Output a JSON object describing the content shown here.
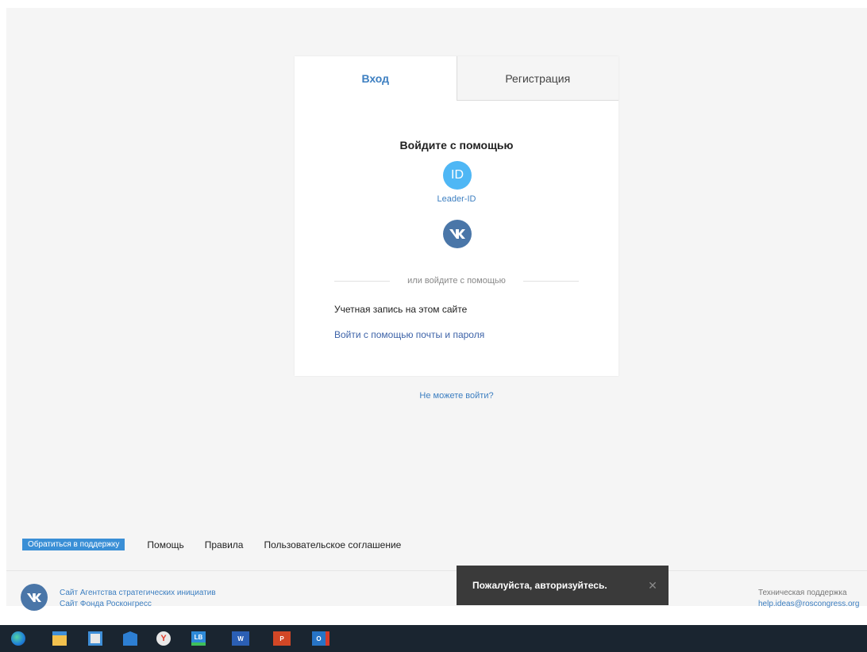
{
  "login": {
    "tab_login": "Вход",
    "tab_register": "Регистрация",
    "title": "Войдите с помощью",
    "leader_id_icon_text": "ID",
    "leader_id_label": "Leader-ID",
    "divider_text": "или войдите с помощью",
    "site_account_label": "Учетная запись на этом сайте",
    "email_login_link": "Войти с помощью почты и пароля",
    "cant_login_link": "Не можете войти?"
  },
  "footer": {
    "support_button": "Обратиться в поддержку",
    "nav": [
      "Помощь",
      "Правила",
      "Пользовательское соглашение"
    ],
    "links": [
      "Сайт Агентства стратегических инициатив",
      "Сайт Фонда Росконгресс"
    ],
    "support_label": "Техническая поддержка",
    "support_email": "help.ideas@roscongress.org"
  },
  "toast": {
    "message": "Пожалуйста, авторизуйтесь.",
    "close": "✕"
  },
  "taskbar": {
    "icons": [
      {
        "name": "edge-icon",
        "label": ""
      },
      {
        "name": "file-explorer-icon",
        "label": ""
      },
      {
        "name": "store-icon",
        "label": ""
      },
      {
        "name": "mail-icon",
        "label": ""
      },
      {
        "name": "yandex-browser-icon",
        "label": "Y"
      },
      {
        "name": "app-lb-icon",
        "label": "LB"
      },
      {
        "name": "word-icon",
        "label": "W"
      },
      {
        "name": "powerpoint-icon",
        "label": "P"
      },
      {
        "name": "outlook-icon",
        "label": "O"
      }
    ]
  },
  "colors": {
    "accent": "#3d7fc1",
    "vk": "#4a76a8",
    "leader_id": "#4fb7f5",
    "support_button": "#3a8fd6",
    "toast_bg": "#3a3a3a",
    "taskbar_bg": "#1a2530"
  }
}
